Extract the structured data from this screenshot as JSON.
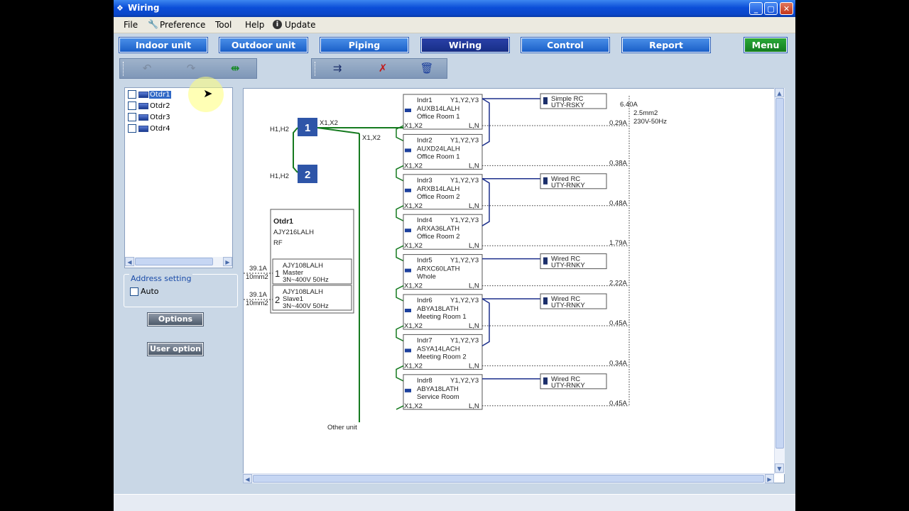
{
  "window": {
    "title": "Wiring",
    "buttons": {
      "minimize": "_",
      "maximize": "▢",
      "close": "✕"
    }
  },
  "menu": {
    "items": [
      "File",
      "Preference",
      "Tool",
      "Help",
      "Update"
    ]
  },
  "tabs": [
    {
      "label": "Indoor unit"
    },
    {
      "label": "Outdoor unit"
    },
    {
      "label": "Piping"
    },
    {
      "label": "Wiring"
    },
    {
      "label": "Control"
    },
    {
      "label": "Report"
    }
  ],
  "menu_button": "Menu",
  "tree": {
    "items": [
      {
        "label": "Otdr1",
        "selected": true
      },
      {
        "label": "Otdr2"
      },
      {
        "label": "Otdr3"
      },
      {
        "label": "Otdr4"
      }
    ]
  },
  "address_setting": {
    "title": "Address setting",
    "auto_label": "Auto"
  },
  "buttons": {
    "options": "Options",
    "user_option": "User option"
  },
  "diagram": {
    "outdoor_main": {
      "name": "Otdr1",
      "model": "AJY216LALH",
      "type": "RF"
    },
    "outdoor_subs": [
      {
        "num": "1",
        "model": "AJY108LALH",
        "role": "Master",
        "power": "3N~400V 50Hz",
        "current": "39.1A",
        "cable": "10mm2"
      },
      {
        "num": "2",
        "model": "AJY108LALH",
        "role": "Slave1",
        "power": "3N~400V 50Hz",
        "current": "39.1A",
        "cable": "10mm2"
      }
    ],
    "branch_boxes": [
      {
        "num": "1",
        "label": "H1,H2"
      },
      {
        "num": "2",
        "label": "H1,H2"
      }
    ],
    "trans_labels": {
      "top": "X1,X2",
      "trunk": "X1,X2",
      "other": "Other unit"
    },
    "indoor_units": [
      {
        "name": "Indr1",
        "model": "AUXB14LALH",
        "room": "Office Room 1",
        "current": "0.29A",
        "rc": "Simple RC",
        "rc_model": "UTY-RSKY"
      },
      {
        "name": "Indr2",
        "model": "AUXD24LALH",
        "room": "Office Room 1",
        "current": "0.38A"
      },
      {
        "name": "Indr3",
        "model": "ARXB14LALH",
        "room": "Office Room 2",
        "current": "0.48A",
        "rc": "Wired RC",
        "rc_model": "UTY-RNKY"
      },
      {
        "name": "Indr4",
        "model": "ARXA36LATH",
        "room": "Office Room 2",
        "current": "1.79A"
      },
      {
        "name": "Indr5",
        "model": "ARXC60LATH",
        "room": "Whole",
        "current": "2.22A",
        "rc": "Wired RC",
        "rc_model": "UTY-RNKY"
      },
      {
        "name": "Indr6",
        "model": "ABYA18LATH",
        "room": "Meeting Room 1",
        "current": "0.45A",
        "rc": "Wired RC",
        "rc_model": "UTY-RNKY"
      },
      {
        "name": "Indr7",
        "model": "ASYA14LACH",
        "room": "Meeting Room 2",
        "current": "0.34A"
      },
      {
        "name": "Indr8",
        "model": "ABYA18LATH",
        "room": "Service Room",
        "current": "0.45A",
        "rc": "Wired RC",
        "rc_model": "UTY-RNKY"
      }
    ],
    "unit_terms": {
      "top": "Y1,Y2,Y3",
      "bl": "X1,X2",
      "br": "L,N"
    },
    "power_summary": {
      "current": "6.40A",
      "cable": "2.5mm2",
      "supply": "230V-50Hz"
    }
  }
}
